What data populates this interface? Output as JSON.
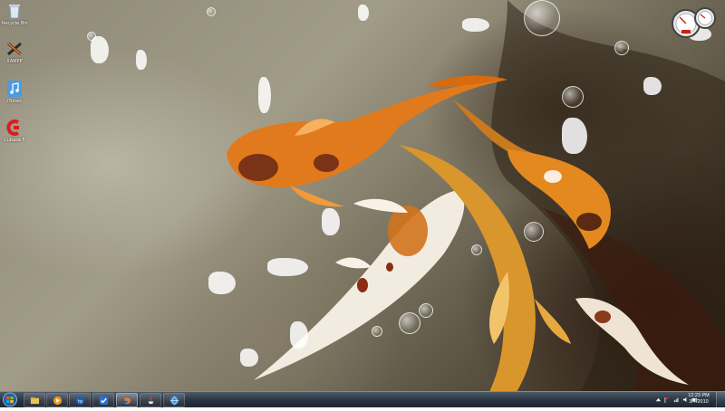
{
  "desktop": {
    "icons": [
      {
        "name": "recycle-bin-icon",
        "label": "Recycle Bin"
      },
      {
        "name": "xampp-icon",
        "label": "XAMPP"
      },
      {
        "name": "itunes-icon",
        "label": "iTunes"
      },
      {
        "name": "cubase-icon",
        "label": "Cubase 5"
      }
    ]
  },
  "taskbar": {
    "pinned": [
      {
        "name": "explorer-icon"
      },
      {
        "name": "media-player-icon"
      },
      {
        "name": "hp-icon"
      },
      {
        "name": "checkmark-app-icon"
      },
      {
        "name": "firefox-icon"
      },
      {
        "name": "java-icon"
      },
      {
        "name": "network-globe-icon"
      }
    ],
    "tray_icons": [
      "arrow-up-icon",
      "flag-icon",
      "network-icon",
      "volume-icon",
      "battery-icon"
    ],
    "clock": {
      "time": "12:23 PM",
      "date": "3/7/2010"
    }
  }
}
